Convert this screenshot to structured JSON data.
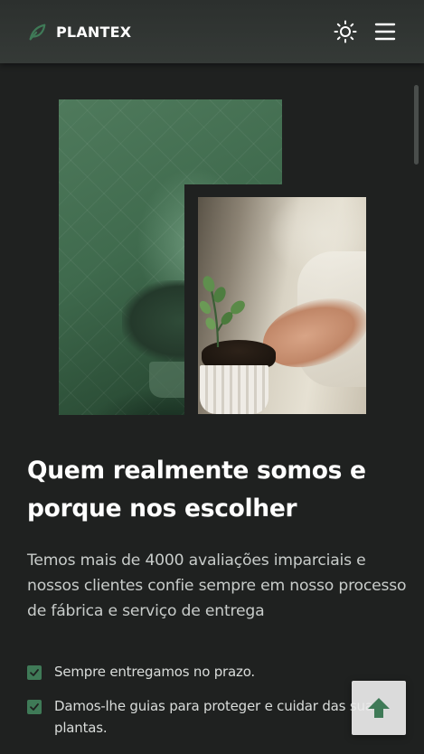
{
  "header": {
    "brand": "PLANTEX",
    "icons": {
      "logo": "leaf-icon",
      "theme": "sun-icon",
      "menu": "hamburger-menu-icon"
    }
  },
  "about": {
    "title": "Quem realmente somos e porque nos escolher",
    "description": "Temos mais de 4000 avaliações imparciais e nossos clientes confie sempre em nosso processo de fábrica e serviço de entrega",
    "items": [
      {
        "text": "Sempre entregamos no prazo.",
        "icon": "check-box-icon"
      },
      {
        "text": "Damos-lhe guias para proteger e cuidar das suas plantas.",
        "icon": "check-box-icon"
      }
    ]
  },
  "scroll_top": {
    "icon": "arrow-up-icon"
  },
  "colors": {
    "background": "#1f2120",
    "header": "#323634",
    "accent": "#3f7a57",
    "title": "#ffffff",
    "text": "#c8ccca"
  }
}
